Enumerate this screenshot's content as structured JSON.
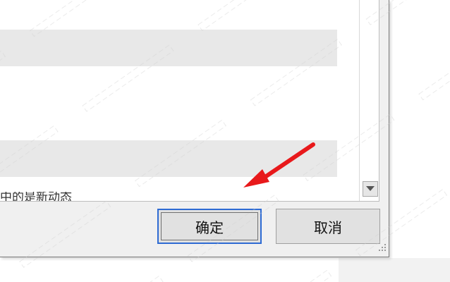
{
  "dialog": {
    "partial_row_text": "中的是新动态",
    "ok_label": "确定",
    "cancel_label": "取消"
  },
  "colors": {
    "accent_focus": "#2e6bd3",
    "arrow": "#e8191b",
    "row_fill": "#e8e8e8"
  }
}
